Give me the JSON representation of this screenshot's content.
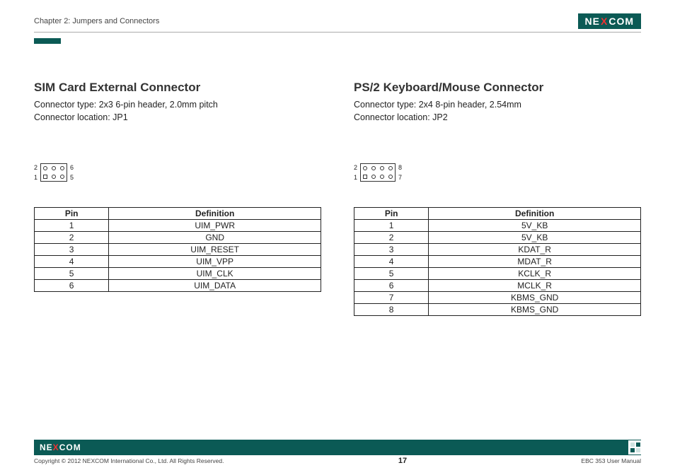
{
  "header": {
    "chapter": "Chapter 2: Jumpers and Connectors",
    "logo_parts": {
      "pre": "NE",
      "x": "X",
      "post": "COM"
    }
  },
  "left": {
    "title": "SIM Card External Connector",
    "type_line": "Connector type: 2x3 6-pin header, 2.0mm pitch",
    "loc_line": "Connector location: JP1",
    "diagram": {
      "rows": 2,
      "cols": 3,
      "top_left_label": "2",
      "bottom_left_label": "1",
      "top_right_label": "6",
      "bottom_right_label": "5",
      "square_pin": "bottom-left"
    },
    "table": {
      "headers": {
        "pin": "Pin",
        "def": "Definition"
      },
      "rows": [
        {
          "pin": "1",
          "def": "UIM_PWR"
        },
        {
          "pin": "2",
          "def": "GND"
        },
        {
          "pin": "3",
          "def": "UIM_RESET"
        },
        {
          "pin": "4",
          "def": "UIM_VPP"
        },
        {
          "pin": "5",
          "def": "UIM_CLK"
        },
        {
          "pin": "6",
          "def": "UIM_DATA"
        }
      ]
    }
  },
  "right": {
    "title": "PS/2 Keyboard/Mouse Connector",
    "type_line": "Connector type: 2x4 8-pin header, 2.54mm",
    "loc_line": "Connector location: JP2",
    "diagram": {
      "rows": 2,
      "cols": 4,
      "top_left_label": "2",
      "bottom_left_label": "1",
      "top_right_label": "8",
      "bottom_right_label": "7",
      "square_pin": "bottom-left"
    },
    "table": {
      "headers": {
        "pin": "Pin",
        "def": "Definition"
      },
      "rows": [
        {
          "pin": "1",
          "def": "5V_KB"
        },
        {
          "pin": "2",
          "def": "5V_KB"
        },
        {
          "pin": "3",
          "def": "KDAT_R"
        },
        {
          "pin": "4",
          "def": "MDAT_R"
        },
        {
          "pin": "5",
          "def": "KCLK_R"
        },
        {
          "pin": "6",
          "def": "MCLK_R"
        },
        {
          "pin": "7",
          "def": "KBMS_GND"
        },
        {
          "pin": "8",
          "def": "KBMS_GND"
        }
      ]
    }
  },
  "footer": {
    "copyright": "Copyright © 2012 NEXCOM International Co., Ltd. All Rights Reserved.",
    "page_number": "17",
    "manual": "EBC 353 User Manual"
  }
}
